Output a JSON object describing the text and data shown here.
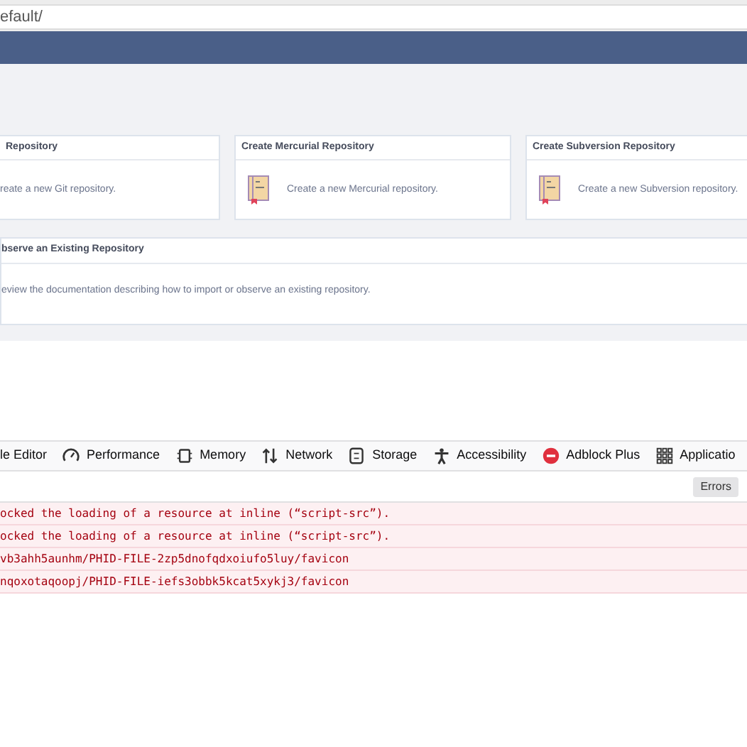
{
  "address_bar": {
    "url": "efault/"
  },
  "cards": [
    {
      "title": "Repository",
      "description": "reate a new Git repository.",
      "has_icon": false
    },
    {
      "title": "Create Mercurial Repository",
      "description": "Create a new Mercurial repository.",
      "has_icon": true
    },
    {
      "title": "Create Subversion Repository",
      "description": "Create a new Subversion repository.",
      "has_icon": true
    }
  ],
  "observe_card": {
    "title": "bserve an Existing Repository",
    "description": "eview the documentation describing how to import or observe an existing repository."
  },
  "devtools": {
    "tabs": [
      {
        "label": "le Editor",
        "kind": "none"
      },
      {
        "label": "Performance",
        "kind": "gauge"
      },
      {
        "label": "Memory",
        "kind": "chip"
      },
      {
        "label": "Network",
        "kind": "arrows"
      },
      {
        "label": "Storage",
        "kind": "storage"
      },
      {
        "label": "Accessibility",
        "kind": "person"
      },
      {
        "label": "Adblock Plus",
        "kind": "abp"
      },
      {
        "label": "Applicatio",
        "kind": "grid"
      }
    ],
    "filter_buttons": [
      "Errors"
    ],
    "log": [
      {
        "text": "ocked the loading of a resource at inline (“script-src”)."
      },
      {
        "text": "ocked the loading of a resource at inline (“script-src”)."
      },
      {
        "text": "vb3ahh5aunhm/PHID-FILE-2zp5dnofqdxoiufo5luy/favicon"
      },
      {
        "text": "nqoxotaqoopj/PHID-FILE-iefs3obbk5kcat5xykj3/favicon"
      }
    ]
  }
}
